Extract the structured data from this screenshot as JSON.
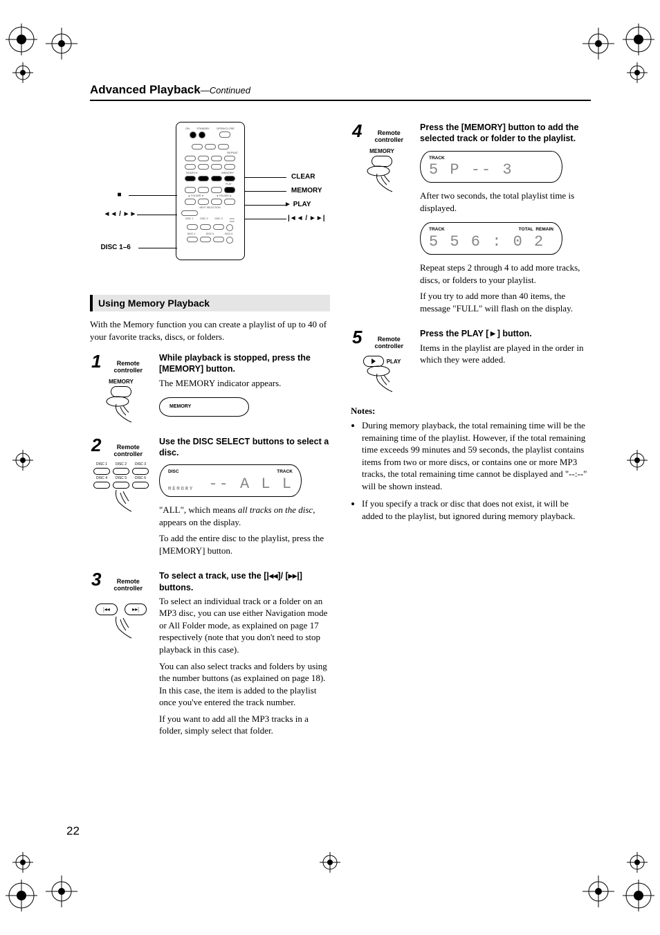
{
  "header": {
    "title": "Advanced Playback",
    "continued": "—Continued"
  },
  "remote_callouts": {
    "clear": "CLEAR",
    "memory": "MEMORY",
    "play": "PLAY",
    "skip_prev_next": "◄◄ / ►►",
    "track_prev_next": "|◄◄ / ►►|",
    "disc": "DISC 1–6",
    "stop": "■",
    "top_labels": {
      "on": "ON",
      "standby": "STANDBY",
      "openclose": "OPEN/CLOSE",
      "repeat": "REPEAT",
      "search": "SEARCH",
      "memory": "MEMORY",
      "folder_up": "▲ FOLDER ▼",
      "folder_side": "◄ FOLDER ►",
      "next_sel": "NEXT SELECTION",
      "play": "PLAY",
      "disc1": "DISC 1",
      "disc2": "DISC 2",
      "disc3": "DISC 3",
      "disc4": "DISC 4",
      "disc5": "DISC 5",
      "disc6": "DISC 6"
    }
  },
  "section_title": "Using Memory Playback",
  "intro": "With the Memory function you can create a playlist of up to 40 of your favorite tracks, discs, or folders.",
  "steps": {
    "s1": {
      "num": "1",
      "sub": "Remote controller",
      "icon_label": "MEMORY",
      "title": "While playback is stopped, press the [MEMORY] button.",
      "body1": "The MEMORY indicator appears.",
      "lcd_text": "MEMORY"
    },
    "s2": {
      "num": "2",
      "sub": "Remote controller",
      "disc_labels": [
        "DISC 1",
        "DISC 2",
        "DISC 3",
        "DISC 4",
        "DISC 5",
        "DISC 6"
      ],
      "title": "Use the DISC SELECT buttons to select a disc.",
      "lcd": {
        "left_top": "DISC",
        "right_top": "TRACK",
        "left_bottom": "MEMORY",
        "seg_left": "--",
        "seg_right": "A L L"
      },
      "body1_a": "\"ALL\", which means ",
      "body1_b": "all tracks on the disc,",
      "body1_c": " appears on the display.",
      "body2": "To add the entire disc to the playlist, press the [MEMORY] button."
    },
    "s3": {
      "num": "3",
      "sub": "Remote controller",
      "title_a": "To select a track, use the [",
      "title_b": "]/ [",
      "title_c": "] buttons.",
      "body1": "To select an individual track or a folder on an MP3 disc, you can use either Navigation mode or All Folder mode, as explained on page 17 respectively (note that you don't need to stop playback in this case).",
      "body2": "You can also select tracks and folders by using the number buttons (as explained on page 18). In this case, the item is added to the playlist once you've entered the track number.",
      "body3": "If you want to add all the MP3 tracks in a folder, simply select that folder."
    },
    "s4": {
      "num": "4",
      "sub": "Remote controller",
      "icon_label": "MEMORY",
      "title": "Press the [MEMORY] button to add the selected track or folder to the playlist.",
      "lcd1": {
        "left_top": "TRACK",
        "seg": "5     P --   3"
      },
      "body1": "After two seconds, the total playlist time is displayed.",
      "lcd2": {
        "left_top": "TRACK",
        "mid_top": "TOTAL",
        "right_top": "REMAIN",
        "seg": "5     5 6 : 0 2"
      },
      "body2": "Repeat steps 2 through 4 to add more tracks, discs, or folders to your playlist.",
      "body3": "If you try to add more than 40 items, the message \"FULL\" will flash on the display."
    },
    "s5": {
      "num": "5",
      "sub": "Remote controller",
      "icon_label": "PLAY",
      "title_a": "Press the PLAY [",
      "title_b": "] button.",
      "body1": "Items in the playlist are played in the order in which they were added."
    }
  },
  "notes": {
    "title": "Notes:",
    "n1": "During memory playback, the total remaining time will be the remaining time of the playlist. However, if the total remaining time exceeds 99 minutes and 59 seconds, the playlist contains items from two or more discs, or contains one or more MP3 tracks, the total remaining time cannot be displayed and \"--:--\" will be shown instead.",
    "n2": "If you specify a track or disc that does not exist, it will be added to the playlist, but ignored during memory playback."
  },
  "page_number": "22"
}
